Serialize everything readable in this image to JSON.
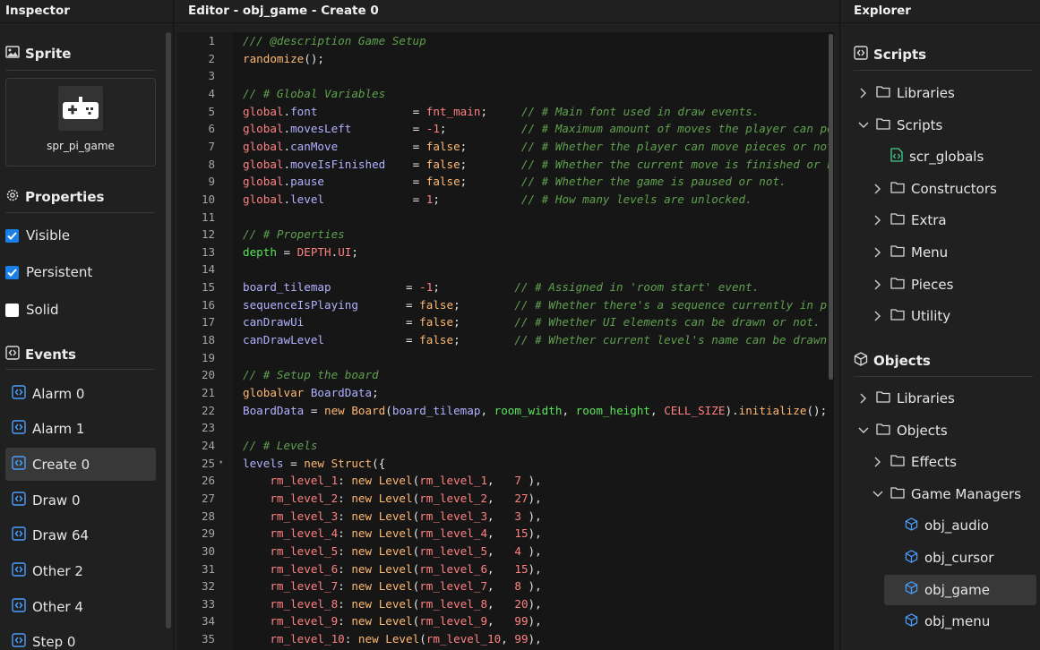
{
  "inspector": {
    "title": "Inspector",
    "sprite_section": "Sprite",
    "sprite_name": "spr_pi_game",
    "properties_section": "Properties",
    "properties": [
      {
        "label": "Visible",
        "checked": true
      },
      {
        "label": "Persistent",
        "checked": true
      },
      {
        "label": "Solid",
        "checked": false
      }
    ],
    "events_section": "Events",
    "events": [
      {
        "label": "Alarm 0",
        "selected": false
      },
      {
        "label": "Alarm 1",
        "selected": false
      },
      {
        "label": "Create 0",
        "selected": true
      },
      {
        "label": "Draw 0",
        "selected": false
      },
      {
        "label": "Draw 64",
        "selected": false
      },
      {
        "label": "Other 2",
        "selected": false
      },
      {
        "label": "Other 4",
        "selected": false
      },
      {
        "label": "Step 0",
        "selected": false
      }
    ]
  },
  "editor": {
    "title": "Editor - obj_game - Create 0",
    "lines": [
      {
        "n": "1",
        "tokens": [
          [
            "cm",
            "/// @description Game Setup"
          ]
        ]
      },
      {
        "n": "2",
        "tokens": [
          [
            "fn",
            "randomize"
          ],
          [
            "op",
            "();"
          ]
        ]
      },
      {
        "n": "3",
        "tokens": []
      },
      {
        "n": "4",
        "tokens": [
          [
            "cm",
            "// # Global Variables"
          ]
        ]
      },
      {
        "n": "5",
        "tokens": [
          [
            "gl",
            "global"
          ],
          [
            "op",
            "."
          ],
          [
            "inst",
            "font"
          ],
          [
            "op",
            "              = "
          ],
          [
            "mac",
            "fnt_main"
          ],
          [
            "op",
            ";     "
          ],
          [
            "cm",
            "// # Main font used in draw events."
          ]
        ]
      },
      {
        "n": "6",
        "tokens": [
          [
            "gl",
            "global"
          ],
          [
            "op",
            "."
          ],
          [
            "inst",
            "movesLeft"
          ],
          [
            "op",
            "         = "
          ],
          [
            "num",
            "-1"
          ],
          [
            "op",
            ";           "
          ],
          [
            "cm",
            "// # Maximum amount of moves the player can pe"
          ]
        ]
      },
      {
        "n": "7",
        "tokens": [
          [
            "gl",
            "global"
          ],
          [
            "op",
            "."
          ],
          [
            "inst",
            "canMove"
          ],
          [
            "op",
            "           = "
          ],
          [
            "kw",
            "false"
          ],
          [
            "op",
            ";        "
          ],
          [
            "cm",
            "// # Whether the player can move pieces or not"
          ]
        ]
      },
      {
        "n": "8",
        "tokens": [
          [
            "gl",
            "global"
          ],
          [
            "op",
            "."
          ],
          [
            "inst",
            "moveIsFinished"
          ],
          [
            "op",
            "    = "
          ],
          [
            "kw",
            "false"
          ],
          [
            "op",
            ";        "
          ],
          [
            "cm",
            "// # Whether the current move is finished or n"
          ]
        ]
      },
      {
        "n": "9",
        "tokens": [
          [
            "gl",
            "global"
          ],
          [
            "op",
            "."
          ],
          [
            "inst",
            "pause"
          ],
          [
            "op",
            "             = "
          ],
          [
            "kw",
            "false"
          ],
          [
            "op",
            ";        "
          ],
          [
            "cm",
            "// # Whether the game is paused or not."
          ]
        ]
      },
      {
        "n": "10",
        "tokens": [
          [
            "gl",
            "global"
          ],
          [
            "op",
            "."
          ],
          [
            "inst",
            "level"
          ],
          [
            "op",
            "             = "
          ],
          [
            "num",
            "1"
          ],
          [
            "op",
            ";            "
          ],
          [
            "cm",
            "// # How many levels are unlocked."
          ]
        ]
      },
      {
        "n": "11",
        "tokens": []
      },
      {
        "n": "12",
        "tokens": [
          [
            "cm",
            "// # Properties"
          ]
        ]
      },
      {
        "n": "13",
        "tokens": [
          [
            "var",
            "depth"
          ],
          [
            "op",
            " = "
          ],
          [
            "mac",
            "DEPTH"
          ],
          [
            "op",
            "."
          ],
          [
            "mac",
            "UI"
          ],
          [
            "op",
            ";"
          ]
        ]
      },
      {
        "n": "14",
        "tokens": []
      },
      {
        "n": "15",
        "tokens": [
          [
            "inst",
            "board_tilemap"
          ],
          [
            "op",
            "           = "
          ],
          [
            "num",
            "-1"
          ],
          [
            "op",
            ";           "
          ],
          [
            "cm",
            "// # Assigned in 'room start' event."
          ]
        ]
      },
      {
        "n": "16",
        "tokens": [
          [
            "inst",
            "sequenceIsPlaying"
          ],
          [
            "op",
            "       = "
          ],
          [
            "kw",
            "false"
          ],
          [
            "op",
            ";        "
          ],
          [
            "cm",
            "// # Whether there's a sequence currently in p"
          ]
        ]
      },
      {
        "n": "17",
        "tokens": [
          [
            "inst",
            "canDrawUi"
          ],
          [
            "op",
            "               = "
          ],
          [
            "kw",
            "false"
          ],
          [
            "op",
            ";        "
          ],
          [
            "cm",
            "// # Whether UI elements can be drawn or not."
          ]
        ]
      },
      {
        "n": "18",
        "tokens": [
          [
            "inst",
            "canDrawLevel"
          ],
          [
            "op",
            "            = "
          ],
          [
            "kw",
            "false"
          ],
          [
            "op",
            ";        "
          ],
          [
            "cm",
            "// # Whether current level's name can be drawn"
          ]
        ]
      },
      {
        "n": "19",
        "tokens": []
      },
      {
        "n": "20",
        "tokens": [
          [
            "cm",
            "// # Setup the board"
          ]
        ]
      },
      {
        "n": "21",
        "tokens": [
          [
            "kw",
            "globalvar"
          ],
          [
            "op",
            " "
          ],
          [
            "inst",
            "BoardData"
          ],
          [
            "op",
            ";"
          ]
        ]
      },
      {
        "n": "22",
        "tokens": [
          [
            "inst",
            "BoardData"
          ],
          [
            "op",
            " = "
          ],
          [
            "kw",
            "new"
          ],
          [
            "op",
            " "
          ],
          [
            "fn",
            "Board"
          ],
          [
            "op",
            "("
          ],
          [
            "inst",
            "board_tilemap"
          ],
          [
            "op",
            ", "
          ],
          [
            "var",
            "room_width"
          ],
          [
            "op",
            ", "
          ],
          [
            "var",
            "room_height"
          ],
          [
            "op",
            ", "
          ],
          [
            "mac",
            "CELL_SIZE"
          ],
          [
            "op",
            ")."
          ],
          [
            "fn",
            "initialize"
          ],
          [
            "op",
            "();"
          ]
        ]
      },
      {
        "n": "23",
        "tokens": []
      },
      {
        "n": "24",
        "tokens": [
          [
            "cm",
            "// # Levels"
          ]
        ]
      },
      {
        "n": "25",
        "fold": true,
        "tokens": [
          [
            "inst",
            "levels"
          ],
          [
            "op",
            " = "
          ],
          [
            "kw",
            "new"
          ],
          [
            "op",
            " "
          ],
          [
            "fn",
            "Struct"
          ],
          [
            "op",
            "({"
          ]
        ]
      },
      {
        "n": "26",
        "tokens": [
          [
            "op",
            "    "
          ],
          [
            "mac",
            "rm_level_1"
          ],
          [
            "op",
            ": "
          ],
          [
            "kw",
            "new"
          ],
          [
            "op",
            " "
          ],
          [
            "fn",
            "Level"
          ],
          [
            "op",
            "("
          ],
          [
            "mac",
            "rm_level_1"
          ],
          [
            "op",
            ",   "
          ],
          [
            "num",
            "7"
          ],
          [
            "op",
            " ),"
          ]
        ]
      },
      {
        "n": "27",
        "tokens": [
          [
            "op",
            "    "
          ],
          [
            "mac",
            "rm_level_2"
          ],
          [
            "op",
            ": "
          ],
          [
            "kw",
            "new"
          ],
          [
            "op",
            " "
          ],
          [
            "fn",
            "Level"
          ],
          [
            "op",
            "("
          ],
          [
            "mac",
            "rm_level_2"
          ],
          [
            "op",
            ",   "
          ],
          [
            "num",
            "27"
          ],
          [
            "op",
            "),"
          ]
        ]
      },
      {
        "n": "28",
        "tokens": [
          [
            "op",
            "    "
          ],
          [
            "mac",
            "rm_level_3"
          ],
          [
            "op",
            ": "
          ],
          [
            "kw",
            "new"
          ],
          [
            "op",
            " "
          ],
          [
            "fn",
            "Level"
          ],
          [
            "op",
            "("
          ],
          [
            "mac",
            "rm_level_3"
          ],
          [
            "op",
            ",   "
          ],
          [
            "num",
            "3"
          ],
          [
            "op",
            " ),"
          ]
        ]
      },
      {
        "n": "29",
        "tokens": [
          [
            "op",
            "    "
          ],
          [
            "mac",
            "rm_level_4"
          ],
          [
            "op",
            ": "
          ],
          [
            "kw",
            "new"
          ],
          [
            "op",
            " "
          ],
          [
            "fn",
            "Level"
          ],
          [
            "op",
            "("
          ],
          [
            "mac",
            "rm_level_4"
          ],
          [
            "op",
            ",   "
          ],
          [
            "num",
            "15"
          ],
          [
            "op",
            "),"
          ]
        ]
      },
      {
        "n": "30",
        "tokens": [
          [
            "op",
            "    "
          ],
          [
            "mac",
            "rm_level_5"
          ],
          [
            "op",
            ": "
          ],
          [
            "kw",
            "new"
          ],
          [
            "op",
            " "
          ],
          [
            "fn",
            "Level"
          ],
          [
            "op",
            "("
          ],
          [
            "mac",
            "rm_level_5"
          ],
          [
            "op",
            ",   "
          ],
          [
            "num",
            "4"
          ],
          [
            "op",
            " ),"
          ]
        ]
      },
      {
        "n": "31",
        "tokens": [
          [
            "op",
            "    "
          ],
          [
            "mac",
            "rm_level_6"
          ],
          [
            "op",
            ": "
          ],
          [
            "kw",
            "new"
          ],
          [
            "op",
            " "
          ],
          [
            "fn",
            "Level"
          ],
          [
            "op",
            "("
          ],
          [
            "mac",
            "rm_level_6"
          ],
          [
            "op",
            ",   "
          ],
          [
            "num",
            "15"
          ],
          [
            "op",
            "),"
          ]
        ]
      },
      {
        "n": "32",
        "tokens": [
          [
            "op",
            "    "
          ],
          [
            "mac",
            "rm_level_7"
          ],
          [
            "op",
            ": "
          ],
          [
            "kw",
            "new"
          ],
          [
            "op",
            " "
          ],
          [
            "fn",
            "Level"
          ],
          [
            "op",
            "("
          ],
          [
            "mac",
            "rm_level_7"
          ],
          [
            "op",
            ",   "
          ],
          [
            "num",
            "8"
          ],
          [
            "op",
            " ),"
          ]
        ]
      },
      {
        "n": "33",
        "tokens": [
          [
            "op",
            "    "
          ],
          [
            "mac",
            "rm_level_8"
          ],
          [
            "op",
            ": "
          ],
          [
            "kw",
            "new"
          ],
          [
            "op",
            " "
          ],
          [
            "fn",
            "Level"
          ],
          [
            "op",
            "("
          ],
          [
            "mac",
            "rm_level_8"
          ],
          [
            "op",
            ",   "
          ],
          [
            "num",
            "20"
          ],
          [
            "op",
            "),"
          ]
        ]
      },
      {
        "n": "34",
        "tokens": [
          [
            "op",
            "    "
          ],
          [
            "mac",
            "rm_level_9"
          ],
          [
            "op",
            ": "
          ],
          [
            "kw",
            "new"
          ],
          [
            "op",
            " "
          ],
          [
            "fn",
            "Level"
          ],
          [
            "op",
            "("
          ],
          [
            "mac",
            "rm_level_9"
          ],
          [
            "op",
            ",   "
          ],
          [
            "num",
            "99"
          ],
          [
            "op",
            "),"
          ]
        ]
      },
      {
        "n": "35",
        "tokens": [
          [
            "op",
            "    "
          ],
          [
            "mac",
            "rm_level_10"
          ],
          [
            "op",
            ": "
          ],
          [
            "kw",
            "new"
          ],
          [
            "op",
            " "
          ],
          [
            "fn",
            "Level"
          ],
          [
            "op",
            "("
          ],
          [
            "mac",
            "rm_level_10"
          ],
          [
            "op",
            ", "
          ],
          [
            "num",
            "99"
          ],
          [
            "op",
            "),"
          ]
        ]
      }
    ]
  },
  "explorer": {
    "title": "Explorer",
    "scripts_section": "Scripts",
    "scripts_tree": [
      {
        "label": "Libraries",
        "kind": "folder",
        "expanded": false,
        "depth": 0
      },
      {
        "label": "Scripts",
        "kind": "folder",
        "expanded": true,
        "depth": 0
      },
      {
        "label": "scr_globals",
        "kind": "script",
        "depth": 1
      },
      {
        "label": "Constructors",
        "kind": "folder",
        "expanded": false,
        "depth": 1
      },
      {
        "label": "Extra",
        "kind": "folder",
        "expanded": false,
        "depth": 1
      },
      {
        "label": "Menu",
        "kind": "folder",
        "expanded": false,
        "depth": 1
      },
      {
        "label": "Pieces",
        "kind": "folder",
        "expanded": false,
        "depth": 1
      },
      {
        "label": "Utility",
        "kind": "folder",
        "expanded": false,
        "depth": 1
      }
    ],
    "objects_section": "Objects",
    "objects_tree": [
      {
        "label": "Libraries",
        "kind": "folder",
        "expanded": false,
        "depth": 0
      },
      {
        "label": "Objects",
        "kind": "folder",
        "expanded": true,
        "depth": 0
      },
      {
        "label": "Effects",
        "kind": "folder",
        "expanded": false,
        "depth": 1
      },
      {
        "label": "Game Managers",
        "kind": "folder",
        "expanded": true,
        "depth": 1
      },
      {
        "label": "obj_audio",
        "kind": "object",
        "depth": 2
      },
      {
        "label": "obj_cursor",
        "kind": "object",
        "depth": 2
      },
      {
        "label": "obj_game",
        "kind": "object",
        "depth": 2,
        "selected": true
      },
      {
        "label": "obj_menu",
        "kind": "object",
        "depth": 2
      }
    ]
  },
  "colors": {
    "accent": "#1a7fe6",
    "event_icon": "#4a9eff",
    "script_icon": "#3fcf8e",
    "object_icon": "#4a9eff",
    "selection": "#383838"
  }
}
